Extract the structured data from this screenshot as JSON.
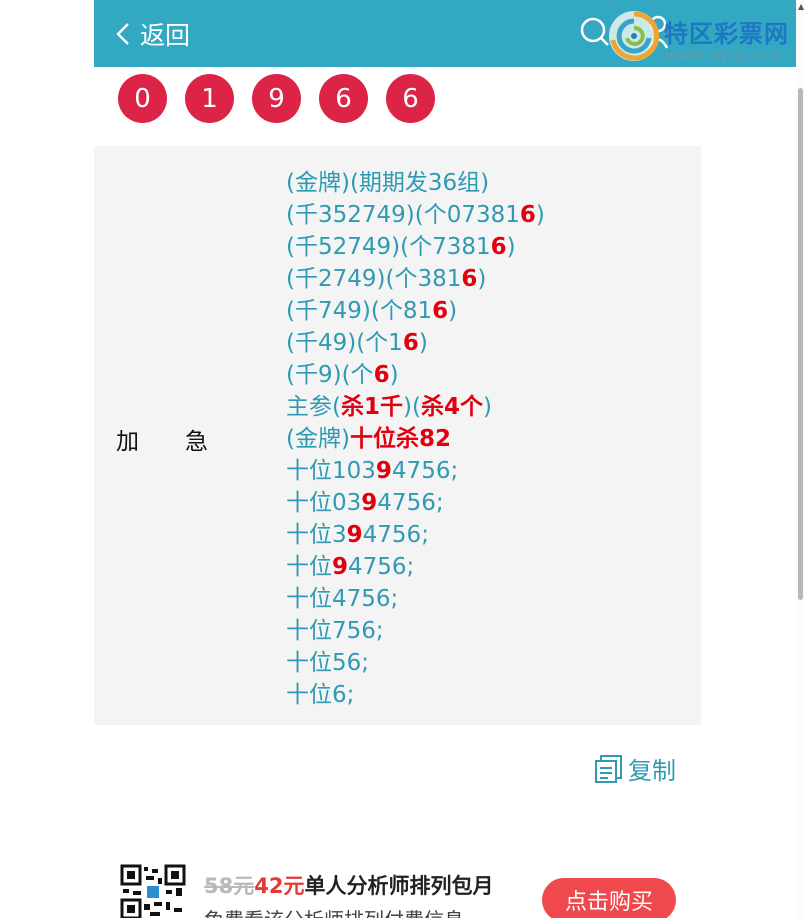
{
  "header": {
    "back_label": "返回",
    "logo_name": "特区彩票网",
    "logo_url": "www.tqcp.net"
  },
  "balls": [
    "0",
    "1",
    "9",
    "6",
    "6"
  ],
  "panel": {
    "label_part1": "加",
    "label_part2": "急",
    "lines": [
      [
        {
          "t": "(金牌)(期期发36组)"
        }
      ],
      [
        {
          "t": "(千352749)(个07381"
        },
        {
          "t": "6",
          "red": true
        },
        {
          "t": ")"
        }
      ],
      [
        {
          "t": "(千52749)(个7381"
        },
        {
          "t": "6",
          "red": true
        },
        {
          "t": ")"
        }
      ],
      [
        {
          "t": "(千2749)(个381"
        },
        {
          "t": "6",
          "red": true
        },
        {
          "t": ")"
        }
      ],
      [
        {
          "t": "(千749)(个81"
        },
        {
          "t": "6",
          "red": true
        },
        {
          "t": ")"
        }
      ],
      [
        {
          "t": "(千49)(个1"
        },
        {
          "t": "6",
          "red": true
        },
        {
          "t": ")"
        }
      ],
      [
        {
          "t": "(千9)(个"
        },
        {
          "t": "6",
          "red": true
        },
        {
          "t": ")"
        }
      ],
      [
        {
          "t": "主参("
        },
        {
          "t": "杀1千",
          "red": true
        },
        {
          "t": ")("
        },
        {
          "t": "杀4个",
          "red": true
        },
        {
          "t": ")"
        }
      ],
      [
        {
          "t": "(金牌)"
        },
        {
          "t": "十位杀82",
          "red": true
        }
      ],
      [
        {
          "t": "十位103"
        },
        {
          "t": "9",
          "red": true
        },
        {
          "t": "4756;"
        }
      ],
      [
        {
          "t": "十位03"
        },
        {
          "t": "9",
          "red": true
        },
        {
          "t": "4756;"
        }
      ],
      [
        {
          "t": "十位3"
        },
        {
          "t": "9",
          "red": true
        },
        {
          "t": "4756;"
        }
      ],
      [
        {
          "t": "十位"
        },
        {
          "t": "9",
          "red": true
        },
        {
          "t": "4756;"
        }
      ],
      [
        {
          "t": "十位4756;"
        }
      ],
      [
        {
          "t": "十位756;"
        }
      ],
      [
        {
          "t": "十位56;"
        }
      ],
      [
        {
          "t": "十位6;"
        }
      ]
    ]
  },
  "copy_label": "复制",
  "promo": {
    "old_price": "58元",
    "new_price": "42元",
    "title": "单人分析师排列包月",
    "subtitle": "免费看该分析师排列付费信息",
    "buy_label": "点击购买"
  },
  "colors": {
    "header_bg": "#33a8c2",
    "ball_bg": "#dc2446",
    "text_teal": "#2f9ab2",
    "highlight_red": "#e20010",
    "buy_button": "#f0494d"
  },
  "icons": [
    "chevron-left-icon",
    "search-icon",
    "user-icon",
    "copy-icon",
    "qr-code-icon"
  ]
}
